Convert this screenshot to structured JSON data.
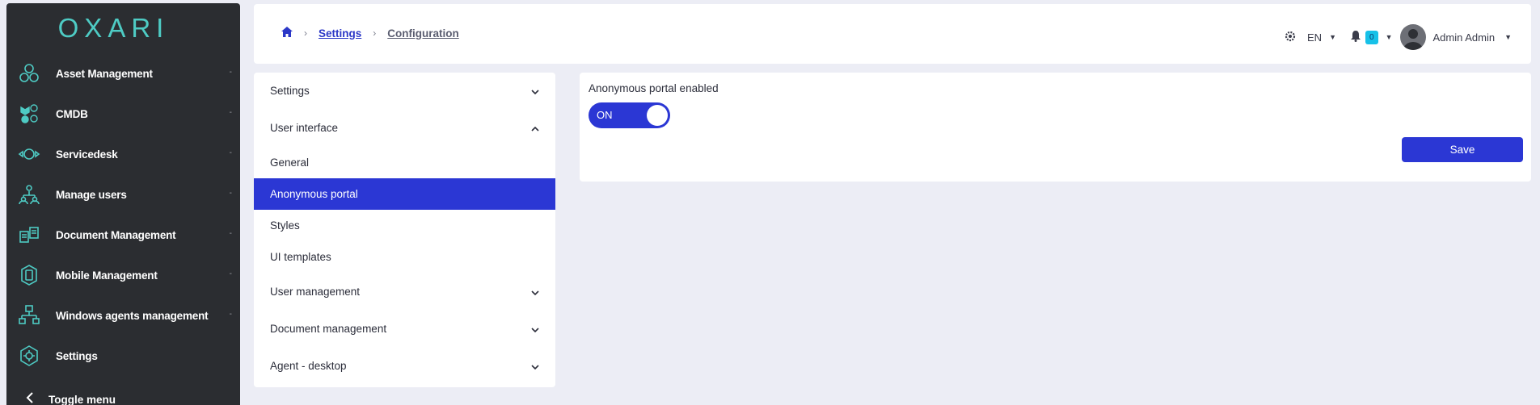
{
  "brand": {
    "logo_text": "OXARI",
    "accent": "#4ecbc4"
  },
  "sidebar": {
    "items": [
      {
        "label": "Asset Management",
        "icon": "hexagon-cluster-icon"
      },
      {
        "label": "CMDB",
        "icon": "cmdb-nodes-icon"
      },
      {
        "label": "Servicedesk",
        "icon": "headset-icon"
      },
      {
        "label": "Manage users",
        "icon": "users-hierarchy-icon"
      },
      {
        "label": "Document Management",
        "icon": "documents-icon"
      },
      {
        "label": "Mobile Management",
        "icon": "mobile-icon"
      },
      {
        "label": "Windows agents management",
        "icon": "network-tree-icon"
      },
      {
        "label": "Settings",
        "icon": "gear-hex-icon"
      }
    ],
    "dash": "-",
    "toggle_label": "Toggle menu"
  },
  "header": {
    "breadcrumb": [
      "Settings",
      "Configuration"
    ],
    "language": "EN",
    "notification_count": "0",
    "user_name": "Admin Admin"
  },
  "settings_menu": {
    "items": [
      {
        "label": "Settings",
        "type": "group",
        "state": "collapsed"
      },
      {
        "label": "User interface",
        "type": "group",
        "state": "expanded"
      },
      {
        "label": "General",
        "type": "item"
      },
      {
        "label": "Anonymous portal",
        "type": "item",
        "active": true
      },
      {
        "label": "Styles",
        "type": "item"
      },
      {
        "label": "UI templates",
        "type": "item"
      },
      {
        "label": "User management",
        "type": "group",
        "state": "collapsed"
      },
      {
        "label": "Document management",
        "type": "group",
        "state": "collapsed"
      },
      {
        "label": "Agent - desktop",
        "type": "group",
        "state": "collapsed"
      }
    ]
  },
  "content": {
    "field_label": "Anonymous portal enabled",
    "toggle_text": "ON",
    "toggle_value": true,
    "save_label": "Save"
  },
  "colors": {
    "primary": "#2b37d4",
    "sidebar_bg": "#2b2d31",
    "page_bg": "#ecedf5",
    "badge": "#17c1e8"
  }
}
